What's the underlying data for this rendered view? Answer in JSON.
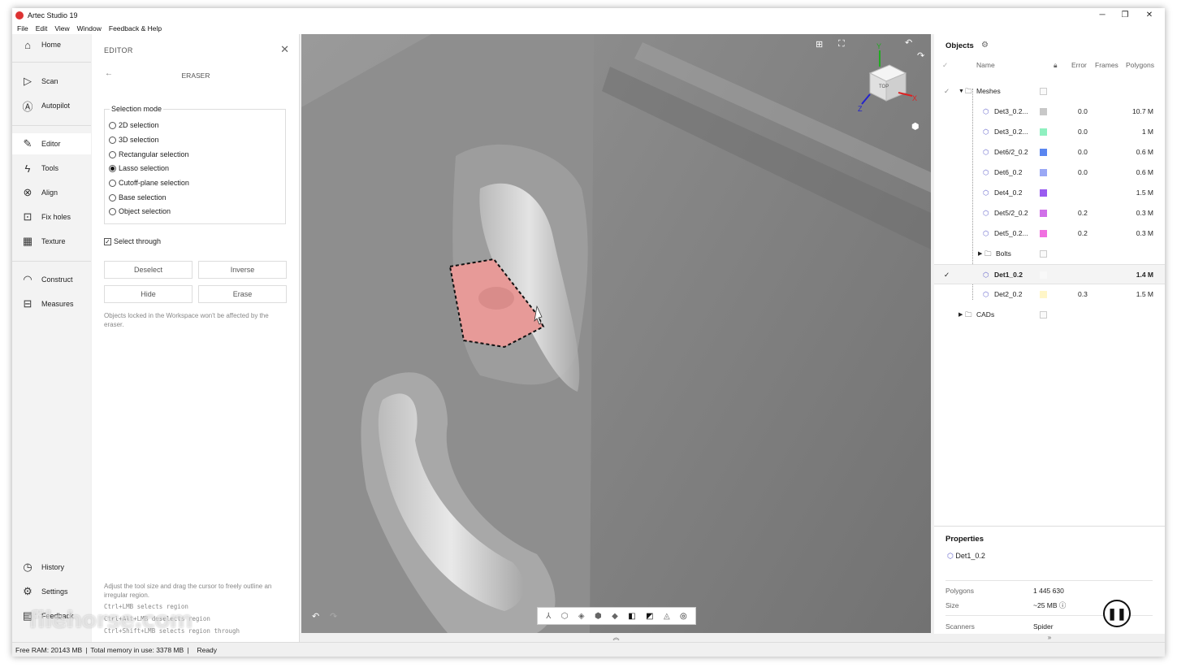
{
  "app": {
    "title": "Artec Studio 19"
  },
  "menu": [
    "File",
    "Edit",
    "View",
    "Window",
    "Feedback & Help"
  ],
  "nav": {
    "top": [
      {
        "label": "Home",
        "icon": "home-icon"
      },
      {
        "label": "Scan",
        "icon": "play-icon"
      },
      {
        "label": "Autopilot",
        "icon": "autopilot-icon"
      },
      {
        "label": "Editor",
        "icon": "pencil-icon"
      },
      {
        "label": "Tools",
        "icon": "lightning-icon"
      },
      {
        "label": "Align",
        "icon": "align-icon"
      },
      {
        "label": "Fix holes",
        "icon": "fix-holes-icon"
      },
      {
        "label": "Texture",
        "icon": "texture-icon"
      },
      {
        "label": "Construct",
        "icon": "construct-icon"
      },
      {
        "label": "Measures",
        "icon": "ruler-icon"
      }
    ],
    "bottom": [
      {
        "label": "History",
        "icon": "history-icon"
      },
      {
        "label": "Settings",
        "icon": "gear-icon"
      },
      {
        "label": "Feedback",
        "icon": "feedback-icon"
      }
    ],
    "active": "Editor"
  },
  "editor": {
    "title": "EDITOR",
    "subtitle": "ERASER",
    "selection_mode_label": "Selection mode",
    "modes": [
      "2D selection",
      "3D selection",
      "Rectangular selection",
      "Lasso selection",
      "Cutoff-plane selection",
      "Base selection",
      "Object selection"
    ],
    "selected_mode": "Lasso selection",
    "select_through_label": "Select through",
    "select_through_checked": true,
    "buttons": {
      "deselect": "Deselect",
      "inverse": "Inverse",
      "hide": "Hide",
      "erase": "Erase"
    },
    "locked_note": "Objects locked in the Workspace won't be affected by the eraser.",
    "help_text": "Adjust the tool size and drag the cursor to freely outline an irregular region.",
    "shortcuts": [
      "Ctrl+LMB selects region",
      "Ctrl+Alt+LMB deselects region",
      "Ctrl+Shift+LMB selects region through"
    ]
  },
  "viewport": {
    "cube_label": "TOP",
    "axes": {
      "x": "X",
      "y": "Y",
      "z": "Z"
    },
    "colors": {
      "selection": "#e79a98",
      "mesh": "#8a8a8a"
    }
  },
  "objects": {
    "title": "Objects",
    "columns": {
      "name": "Name",
      "error": "Error",
      "frames": "Frames",
      "polygons": "Polygons"
    },
    "rows": [
      {
        "name": "Meshes",
        "type": "folder",
        "checked": true,
        "error": "",
        "polygons": "",
        "color": ""
      },
      {
        "name": "Det3_0.2...",
        "type": "mesh",
        "checked": false,
        "error": "0.0",
        "polygons": "10.7 M",
        "color": "#c8c8c8"
      },
      {
        "name": "Det3_0.2...",
        "type": "mesh",
        "checked": false,
        "error": "0.0",
        "polygons": "1 M",
        "color": "#8ff0c0"
      },
      {
        "name": "Det6/2_0.2",
        "type": "mesh",
        "checked": false,
        "error": "0.0",
        "polygons": "0.6 M",
        "color": "#5a86f0"
      },
      {
        "name": "Det6_0.2",
        "type": "mesh",
        "checked": false,
        "error": "0.0",
        "polygons": "0.6 M",
        "color": "#9aa8f5"
      },
      {
        "name": "Det4_0.2",
        "type": "mesh",
        "checked": false,
        "error": "",
        "polygons": "1.5 M",
        "color": "#9a5cf0"
      },
      {
        "name": "Det5/2_0.2",
        "type": "mesh",
        "checked": false,
        "error": "0.2",
        "polygons": "0.3 M",
        "color": "#d070e8"
      },
      {
        "name": "Det5_0.2...",
        "type": "mesh",
        "checked": false,
        "error": "0.2",
        "polygons": "0.3 M",
        "color": "#f070e0"
      },
      {
        "name": "Bolts",
        "type": "folder",
        "checked": false,
        "error": "",
        "polygons": "",
        "color": ""
      },
      {
        "name": "Det1_0.2",
        "type": "mesh",
        "checked": true,
        "selected": true,
        "error": "",
        "polygons": "1.4 M",
        "color": "#f8f8f8"
      },
      {
        "name": "Det2_0.2",
        "type": "mesh",
        "checked": false,
        "error": "0.3",
        "polygons": "1.5 M",
        "color": "#fff6c8"
      },
      {
        "name": "CADs",
        "type": "folder",
        "checked": false,
        "error": "",
        "polygons": "",
        "color": ""
      }
    ]
  },
  "properties": {
    "title": "Properties",
    "object": "Det1_0.2",
    "rows": [
      {
        "key": "Polygons",
        "value": "1 445 630"
      },
      {
        "key": "Size",
        "value": "~25 MB"
      },
      {
        "key": "Scanners",
        "value": "Spider"
      }
    ]
  },
  "status": {
    "free_ram": "Free RAM: 20143 MB",
    "total_memory": "Total memory in use: 3378 MB",
    "state": "Ready"
  },
  "watermark": "filehorse.com"
}
